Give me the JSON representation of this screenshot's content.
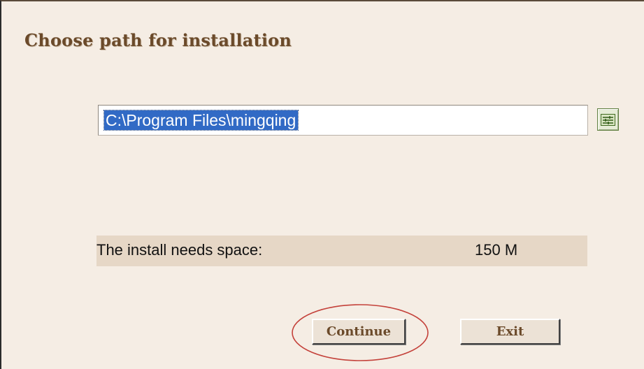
{
  "dialog": {
    "title": "Choose path for installation"
  },
  "path": {
    "value": "C:\\Program Files\\mingqing",
    "selected": true
  },
  "browse_button": {
    "icon": "browse-folder-icon"
  },
  "space": {
    "label": "The install needs space:",
    "value": "150 M"
  },
  "buttons": {
    "continue_label": "Continue",
    "exit_label": "Exit"
  },
  "annotation": {
    "highlight_color": "#c4413a",
    "highlighted": "Continue"
  },
  "colors": {
    "background": "#f5ede4",
    "title": "#6b4a2a",
    "selection": "#316ac5",
    "space_row": "#e6d7c6"
  }
}
